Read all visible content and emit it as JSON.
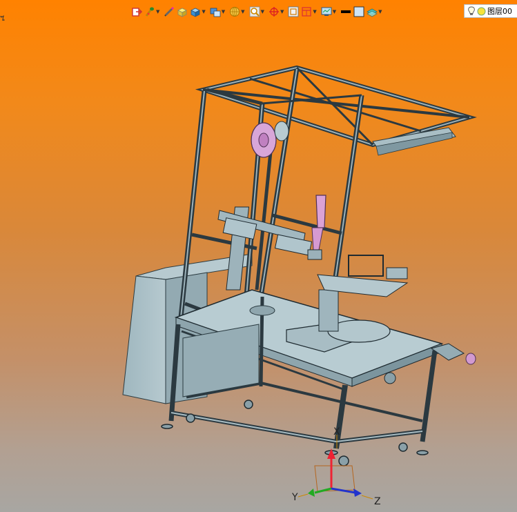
{
  "toolbar": {
    "layer_label": "图层00",
    "tools": [
      {
        "name": "exit-sketch-icon",
        "dropdown": false
      },
      {
        "name": "paint-brush-icon",
        "dropdown": true
      },
      {
        "name": "edit-pencil-icon",
        "dropdown": false
      },
      {
        "name": "solid-box-yellow-icon",
        "dropdown": false
      },
      {
        "name": "solid-box-blue-icon",
        "dropdown": true
      },
      {
        "name": "view-orientation-icon",
        "dropdown": true
      },
      {
        "name": "render-sphere-icon",
        "dropdown": true
      },
      {
        "name": "zoom-icon",
        "dropdown": true
      },
      {
        "name": "rotate-target-icon",
        "dropdown": true
      },
      {
        "name": "fit-window-icon",
        "dropdown": false
      },
      {
        "name": "section-view-icon",
        "dropdown": true
      },
      {
        "name": "display-settings-icon",
        "dropdown": true
      },
      {
        "name": "line-color-icon",
        "dropdown": false
      },
      {
        "name": "fill-color-icon",
        "dropdown": false
      },
      {
        "name": "layer-stack-icon",
        "dropdown": true
      }
    ]
  },
  "corner_mark": "ጜ",
  "triad": {
    "x_label": "X",
    "y_label": "Y",
    "z_label": "Z"
  },
  "colors": {
    "background_top": "#ff8200",
    "background_bottom": "#a8a6a2",
    "model_steel": "#a8c0c8",
    "model_edge": "#1e2a30",
    "accent_pink": "#d8a0d8"
  }
}
